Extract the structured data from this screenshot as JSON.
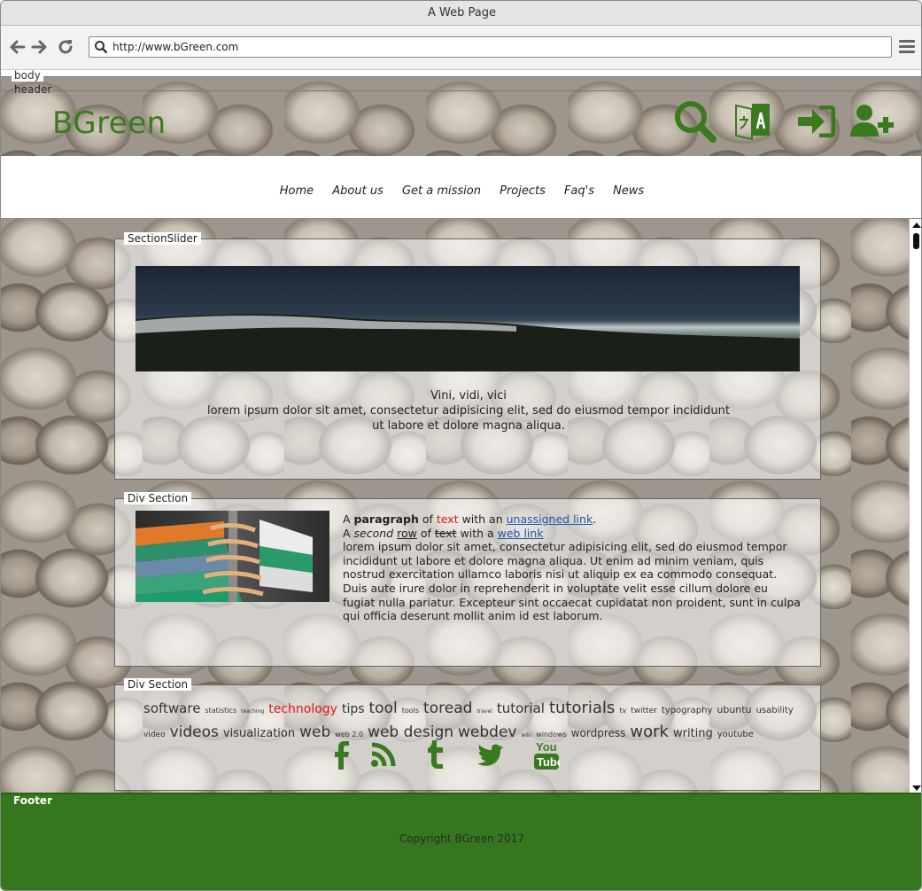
{
  "window": {
    "title": "A Web Page",
    "url": "http://www.bGreen.com"
  },
  "frames": {
    "body_label": "body",
    "header_label": "header",
    "footer_label": "Footer"
  },
  "header": {
    "logo": "BGreen",
    "icons": [
      "search-icon",
      "translate-icon",
      "sign-in-icon",
      "add-user-icon"
    ],
    "nav": [
      "Home",
      "About us",
      "Get a mission",
      "Projects",
      "Faq's",
      "News"
    ]
  },
  "slider": {
    "title": "SectionSlider",
    "caption_title": "Vini, vidi, vici",
    "caption_text": "lorem ipsum dolor sit amet, consectetur adipisicing elit, sed do eiusmod tempor incididunt ut labore et dolore magna aliqua."
  },
  "div1": {
    "title": "Div Section",
    "p1": {
      "a": "A ",
      "b": "paragraph",
      "c": " of ",
      "d": "text",
      "e": " with an ",
      "f": "unassigned link",
      "g": "."
    },
    "p2": {
      "a": "A ",
      "b": "second",
      "c": " ",
      "d": "row",
      "e": " of ",
      "f": "text",
      "g": " with a ",
      "h": "web link"
    },
    "body": "lorem ipsum dolor sit amet, consectetur adipisicing elit, sed do eiusmod tempor incididunt ut labore et dolore magna aliqua. Ut enim ad minim veniam, quis nostrud exercitation ullamco laboris nisi ut aliquip ex ea commodo consequat. Duis aute irure dolor in reprehenderit in voluptate velit esse cillum dolore eu fugiat nulla pariatur. Excepteur sint occaecat cupidatat non proident, sunt in culpa qui officia deserunt mollit anim id est laborum."
  },
  "div2": {
    "title": "Div Section",
    "tags": [
      {
        "t": "software",
        "s": 15
      },
      {
        "t": "statistics",
        "s": 8
      },
      {
        "t": "teaching",
        "s": 6
      },
      {
        "t": "technology",
        "s": 14,
        "red": true
      },
      {
        "t": "tips",
        "s": 14
      },
      {
        "t": "tool",
        "s": 17
      },
      {
        "t": "tools",
        "s": 8
      },
      {
        "t": "toread",
        "s": 17
      },
      {
        "t": "travel",
        "s": 6
      },
      {
        "t": "tutorial",
        "s": 15
      },
      {
        "t": "tutorials",
        "s": 18
      },
      {
        "t": "tv",
        "s": 8
      },
      {
        "t": "twitter",
        "s": 9
      },
      {
        "t": "typography",
        "s": 10
      },
      {
        "t": "ubuntu",
        "s": 11
      },
      {
        "t": "usability",
        "s": 10
      },
      {
        "t": "video",
        "s": 9
      },
      {
        "t": "videos",
        "s": 17
      },
      {
        "t": "visualization",
        "s": 13
      },
      {
        "t": "web",
        "s": 17
      },
      {
        "t": "web 2.0",
        "s": 8
      },
      {
        "t": "web design",
        "s": 17
      },
      {
        "t": "webdev",
        "s": 17
      },
      {
        "t": "wiki",
        "s": 6
      },
      {
        "t": "windows",
        "s": 8
      },
      {
        "t": "wordpress",
        "s": 12
      },
      {
        "t": "work",
        "s": 18
      },
      {
        "t": "writing",
        "s": 13
      },
      {
        "t": "youtube",
        "s": 10
      }
    ],
    "social": [
      "facebook-icon",
      "rss-icon",
      "tumblr-icon",
      "twitter-icon",
      "youtube-icon"
    ]
  },
  "footer": {
    "copyright": "Copyright BGreen 2017"
  },
  "colors": {
    "brand_green": "#3a7a1f",
    "footer_green": "#34771d",
    "link_blue": "#1a56a8",
    "accent_red": "#d61a1a"
  }
}
